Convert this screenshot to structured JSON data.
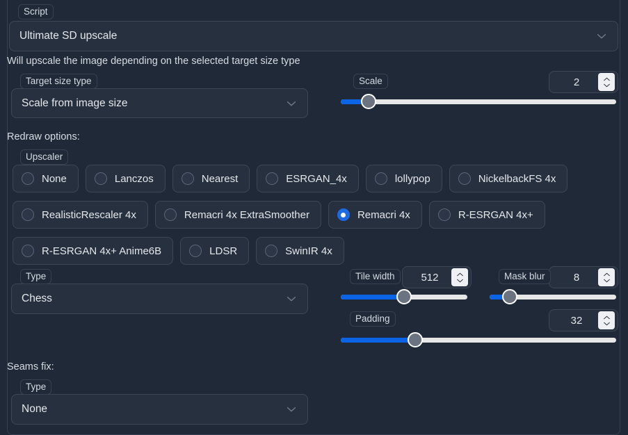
{
  "panel": {
    "legend": "Script",
    "script_select": {
      "value": "Ultimate SD upscale",
      "chevron": "chevron-down-icon"
    },
    "description": "Will upscale the image depending on the selected target size type"
  },
  "target_size": {
    "label": "Target size type",
    "value": "Scale from image size"
  },
  "scale": {
    "label": "Scale",
    "value": "2",
    "percent": 10
  },
  "redraw": {
    "section_label": "Redraw options:",
    "upscaler_label": "Upscaler",
    "upscalers": [
      {
        "label": "None",
        "checked": false
      },
      {
        "label": "Lanczos",
        "checked": false
      },
      {
        "label": "Nearest",
        "checked": false
      },
      {
        "label": "ESRGAN_4x",
        "checked": false
      },
      {
        "label": "lollypop",
        "checked": false
      },
      {
        "label": "NickelbackFS 4x",
        "checked": false
      },
      {
        "label": "RealisticRescaler 4x",
        "checked": false
      },
      {
        "label": "Remacri 4x ExtraSmoother",
        "checked": false
      },
      {
        "label": "Remacri 4x",
        "checked": true
      },
      {
        "label": "R-ESRGAN 4x+",
        "checked": false
      },
      {
        "label": "R-ESRGAN 4x+ Anime6B",
        "checked": false
      },
      {
        "label": "LDSR",
        "checked": false
      },
      {
        "label": "SwinIR 4x",
        "checked": false
      }
    ],
    "type": {
      "label": "Type",
      "value": "Chess"
    },
    "tile_width": {
      "label": "Tile width",
      "value": "512",
      "percent": 50
    },
    "mask_blur": {
      "label": "Mask blur",
      "value": "8",
      "percent": 16
    },
    "padding": {
      "label": "Padding",
      "value": "32",
      "percent": 27
    }
  },
  "seams_fix": {
    "section_label": "Seams fix:",
    "type": {
      "label": "Type",
      "value": "None"
    }
  },
  "colors": {
    "background": "#1f2937",
    "field": "#26303f",
    "border": "#3d4756",
    "accent": "#1d6ae5",
    "slider_fill": "#0b63e5",
    "slider_track": "#e7e7e7",
    "knob": "#6b7280",
    "text": "#e5e7eb"
  }
}
